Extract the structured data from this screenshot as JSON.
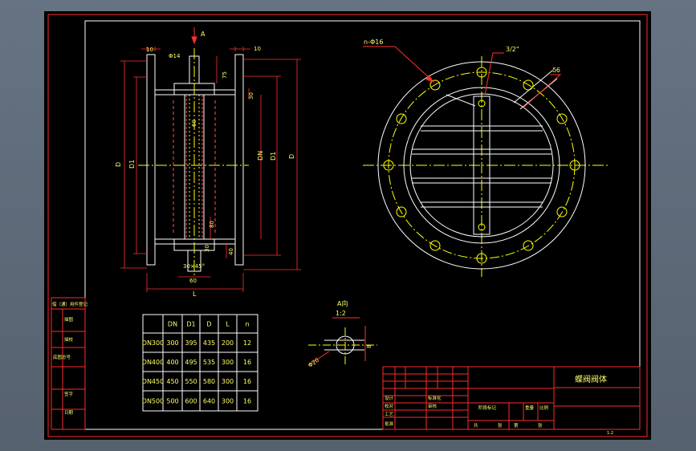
{
  "colors": {
    "background": "#000000",
    "frame": "#ff2a2a",
    "outline": "#ffffff",
    "centerline": "#ffff00",
    "dimension": "#ff3030",
    "hidden": "#ff5050",
    "text": "#ffff66"
  },
  "view_label": "A",
  "dims": {
    "d10_left": "10",
    "phi14": "Φ14",
    "d10_right": "10",
    "d75": "75",
    "d30": "30",
    "d60": "60",
    "D_left": "D",
    "D1_left": "D1",
    "DN": "DN",
    "D1_right": "D1",
    "D_right": "D",
    "d80": "80",
    "d40": "40",
    "d30_lower": "30",
    "d45deg": "30×45°",
    "d60_bottom": "60",
    "L": "L"
  },
  "circle_dims": {
    "n_holes": "n-Φ16",
    "thread": "3/2\"",
    "delta": "δ6"
  },
  "a_view": {
    "title": "A向",
    "scale": "1:2",
    "dim8": "8",
    "dim20": "Φ20"
  },
  "table": {
    "headers": [
      "",
      "DN",
      "D1",
      "D",
      "L",
      "n"
    ],
    "rows": [
      [
        "DN300",
        "300",
        "395",
        "435",
        "200",
        "12"
      ],
      [
        "DN400",
        "400",
        "495",
        "535",
        "300",
        "16"
      ],
      [
        "DN450",
        "450",
        "550",
        "580",
        "300",
        "16"
      ],
      [
        "DN500",
        "500",
        "600",
        "640",
        "300",
        "16"
      ]
    ]
  },
  "side_labels": [
    "借（通）用件登记",
    "描图",
    "描校",
    "底图总号",
    "签字",
    "日期"
  ],
  "title_block": {
    "name": "蝶阀阀体",
    "r_design": "设计",
    "r_std": "标准化",
    "r_check": "校对",
    "r_review": "审核",
    "r_process": "工艺",
    "r_approve": "批准",
    "stage_label": "阶段标记",
    "weight_label": "重量",
    "scale_label": "比例",
    "sheet_a": "共",
    "sheet_b": "张",
    "sheet_c": "第",
    "sheet_d": "张",
    "mark": "1:2"
  }
}
